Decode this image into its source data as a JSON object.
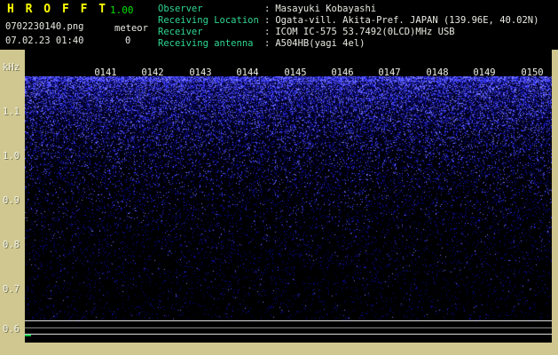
{
  "app": {
    "title": "H R O F F T",
    "version": "1.00",
    "filename": "0702230140.png",
    "mode": "meteor",
    "datetime": "07.02.23 01:40",
    "echo_count": "0"
  },
  "header_info": {
    "separator": ":",
    "rows": [
      {
        "label": "Observer",
        "value": "Masayuki Kobayashi"
      },
      {
        "label": "Receiving Location",
        "value": "Ogata-vill. Akita-Pref. JAPAN (139.96E, 40.02N)"
      },
      {
        "label": "Receiver",
        "value": "ICOM IC-575 53.7492(0LCD)MHz USB"
      },
      {
        "label": "Receiving antenna",
        "value": "A504HB(yagi 4el)"
      }
    ]
  },
  "chart_data": {
    "type": "heatmap",
    "title": "",
    "description": "10-minute radio meteor observation spectrogram (waterfall); background noise only, no meteor echoes recorded (echo count 0)",
    "x_ticks": [
      "0141",
      "0142",
      "0143",
      "0144",
      "0145",
      "0146",
      "0147",
      "0148",
      "0149",
      "0150"
    ],
    "x_unit": "time HHMM",
    "y_axis_label": "kHz",
    "y_ticks": [
      "1.1",
      "1.0",
      "0.9",
      "0.8",
      "0.7",
      "0.6"
    ],
    "ylim": [
      0.6,
      1.2
    ],
    "grid": false,
    "noise": {
      "palette": [
        "#000078",
        "#0d0da8",
        "#2222d8",
        "#4848ff",
        "#7b7bff"
      ],
      "density_top": 0.52,
      "density_bottom": 0.02
    }
  },
  "colors": {
    "page_bg": "#cfc78f",
    "panel_bg": "#000000",
    "title_yellow": "#ffff00",
    "version_green": "#00e400",
    "label_green": "#2fd792",
    "text_white": "#e9e9e2"
  }
}
